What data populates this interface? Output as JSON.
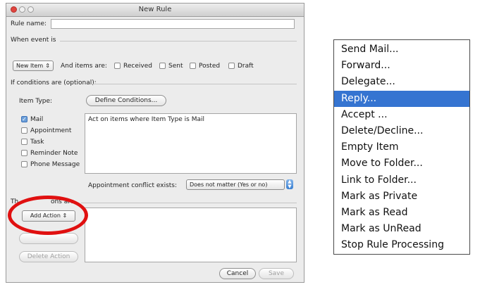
{
  "window": {
    "title": "New Rule"
  },
  "rule_name": {
    "label": "Rule name:",
    "value": ""
  },
  "when_event": {
    "label": "When event is",
    "event_popup": "New Item",
    "items_label": "And items are:",
    "checkboxes": [
      {
        "label": "Received",
        "checked": false
      },
      {
        "label": "Sent",
        "checked": false
      },
      {
        "label": "Posted",
        "checked": false
      },
      {
        "label": "Draft",
        "checked": false
      }
    ]
  },
  "conditions": {
    "label": "If conditions are (optional):",
    "item_type_label": "Item Type:",
    "define_button": "Define Conditions...",
    "types": [
      {
        "label": "Mail",
        "checked": true
      },
      {
        "label": "Appointment",
        "checked": false
      },
      {
        "label": "Task",
        "checked": false
      },
      {
        "label": "Reminder Note",
        "checked": false
      },
      {
        "label": "Phone Message",
        "checked": false
      }
    ],
    "description": "Act on items where Item Type is Mail",
    "conflict_label": "Appointment conflict exists:",
    "conflict_value": "Does not matter (Yes or no)"
  },
  "actions": {
    "label_partial": "Th                ons are",
    "add_action": "Add Action",
    "delete_action": "Delete Action"
  },
  "footer": {
    "cancel": "Cancel",
    "save": "Save"
  },
  "action_menu": {
    "items": [
      {
        "label": "Send Mail...",
        "selected": false
      },
      {
        "label": "Forward...",
        "selected": false
      },
      {
        "label": "Delegate...",
        "selected": false
      },
      {
        "label": "Reply...",
        "selected": true
      },
      {
        "label": "Accept ...",
        "selected": false
      },
      {
        "label": "Delete/Decline...",
        "selected": false
      },
      {
        "label": "Empty Item",
        "selected": false
      },
      {
        "label": "Move to Folder...",
        "selected": false
      },
      {
        "label": "Link to Folder...",
        "selected": false
      },
      {
        "label": "Mark as Private",
        "selected": false
      },
      {
        "label": "Mark as Read",
        "selected": false
      },
      {
        "label": "Mark as UnRead",
        "selected": false
      },
      {
        "label": "Stop Rule Processing",
        "selected": false
      }
    ]
  },
  "colors": {
    "highlight": "#3574d1",
    "annotation_ring": "#e01010"
  }
}
